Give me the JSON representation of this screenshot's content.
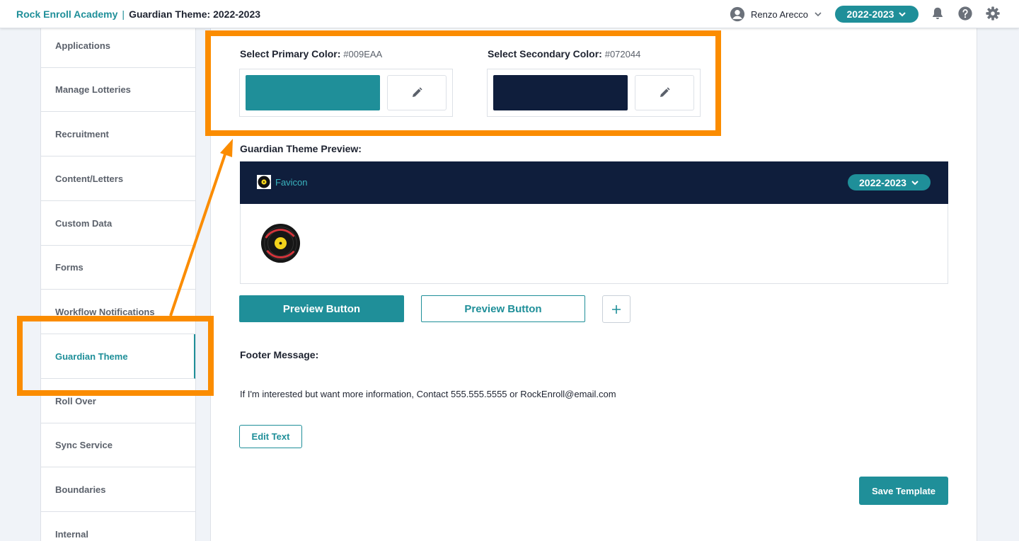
{
  "header": {
    "school_name": "Rock Enroll Academy",
    "separator": "|",
    "breadcrumb": "Guardian Theme: 2022-2023",
    "user_name": "Renzo Arecco",
    "year": "2022-2023",
    "icons": [
      "user-icon",
      "chevron-down-icon",
      "bell-icon",
      "help-icon",
      "gear-icon"
    ]
  },
  "sidebar": {
    "items": [
      {
        "label": "Applications"
      },
      {
        "label": "Manage Lotteries"
      },
      {
        "label": "Recruitment"
      },
      {
        "label": "Content/Letters"
      },
      {
        "label": "Custom Data"
      },
      {
        "label": "Forms"
      },
      {
        "label": "Workflow Notifications"
      },
      {
        "label": "Guardian Theme",
        "active": true
      },
      {
        "label": "Roll Over"
      },
      {
        "label": "Sync Service"
      },
      {
        "label": "Boundaries"
      },
      {
        "label": "Internal"
      }
    ]
  },
  "theme": {
    "primary_label": "Select Primary Color:",
    "primary_hex": "#009EAA",
    "secondary_label": "Select Secondary Color:",
    "secondary_hex": "#072044",
    "primary_swatch_color": "#1f8f99",
    "secondary_swatch_color": "#0f1e3c"
  },
  "preview": {
    "title": "Guardian Theme Preview:",
    "favicon_label": "Favicon",
    "year": "2022-2023",
    "primary_button": "Preview Button",
    "outline_button": "Preview Button",
    "add_icon": "plus-icon"
  },
  "footer": {
    "title": "Footer Message:",
    "message": "If I'm interested but want more information, Contact 555.555.5555 or RockEnroll@email.com",
    "edit_button": "Edit Text"
  },
  "actions": {
    "save_button": "Save Template"
  },
  "colors": {
    "accent": "#1f8f99",
    "navy": "#0f1e3c",
    "highlight": "#fb8c00"
  }
}
